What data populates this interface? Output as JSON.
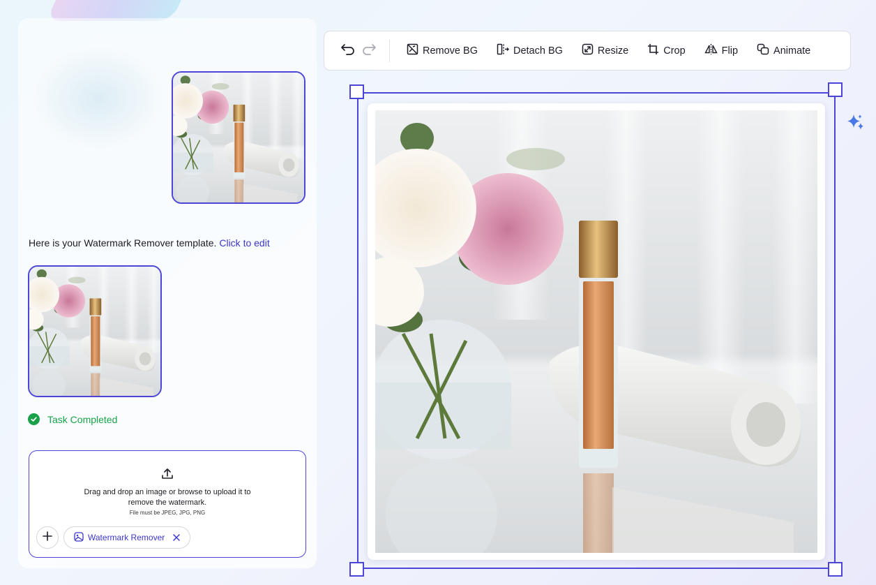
{
  "chat": {
    "message_text": "Here is your Watermark Remover template.",
    "message_link": "Click to edit",
    "status": "Task Completed"
  },
  "upload": {
    "line1": "Drag and drop an image or browse to upload it to",
    "line2": "remove the watermark.",
    "hint": "File must be JPEG, JPG, PNG",
    "chip_label": "Watermark Remover"
  },
  "toolbar": {
    "remove_bg": "Remove BG",
    "detach_bg": "Detach BG",
    "resize": "Resize",
    "crop": "Crop",
    "flip": "Flip",
    "animate": "Animate"
  },
  "icons": {
    "undo": "undo-icon",
    "redo": "redo-icon",
    "upload": "upload-icon",
    "check": "check-circle-icon",
    "sparkle": "sparkle-icon"
  },
  "colors": {
    "accent": "#4b46d8",
    "success": "#19a04a",
    "link": "#3b36c9"
  }
}
